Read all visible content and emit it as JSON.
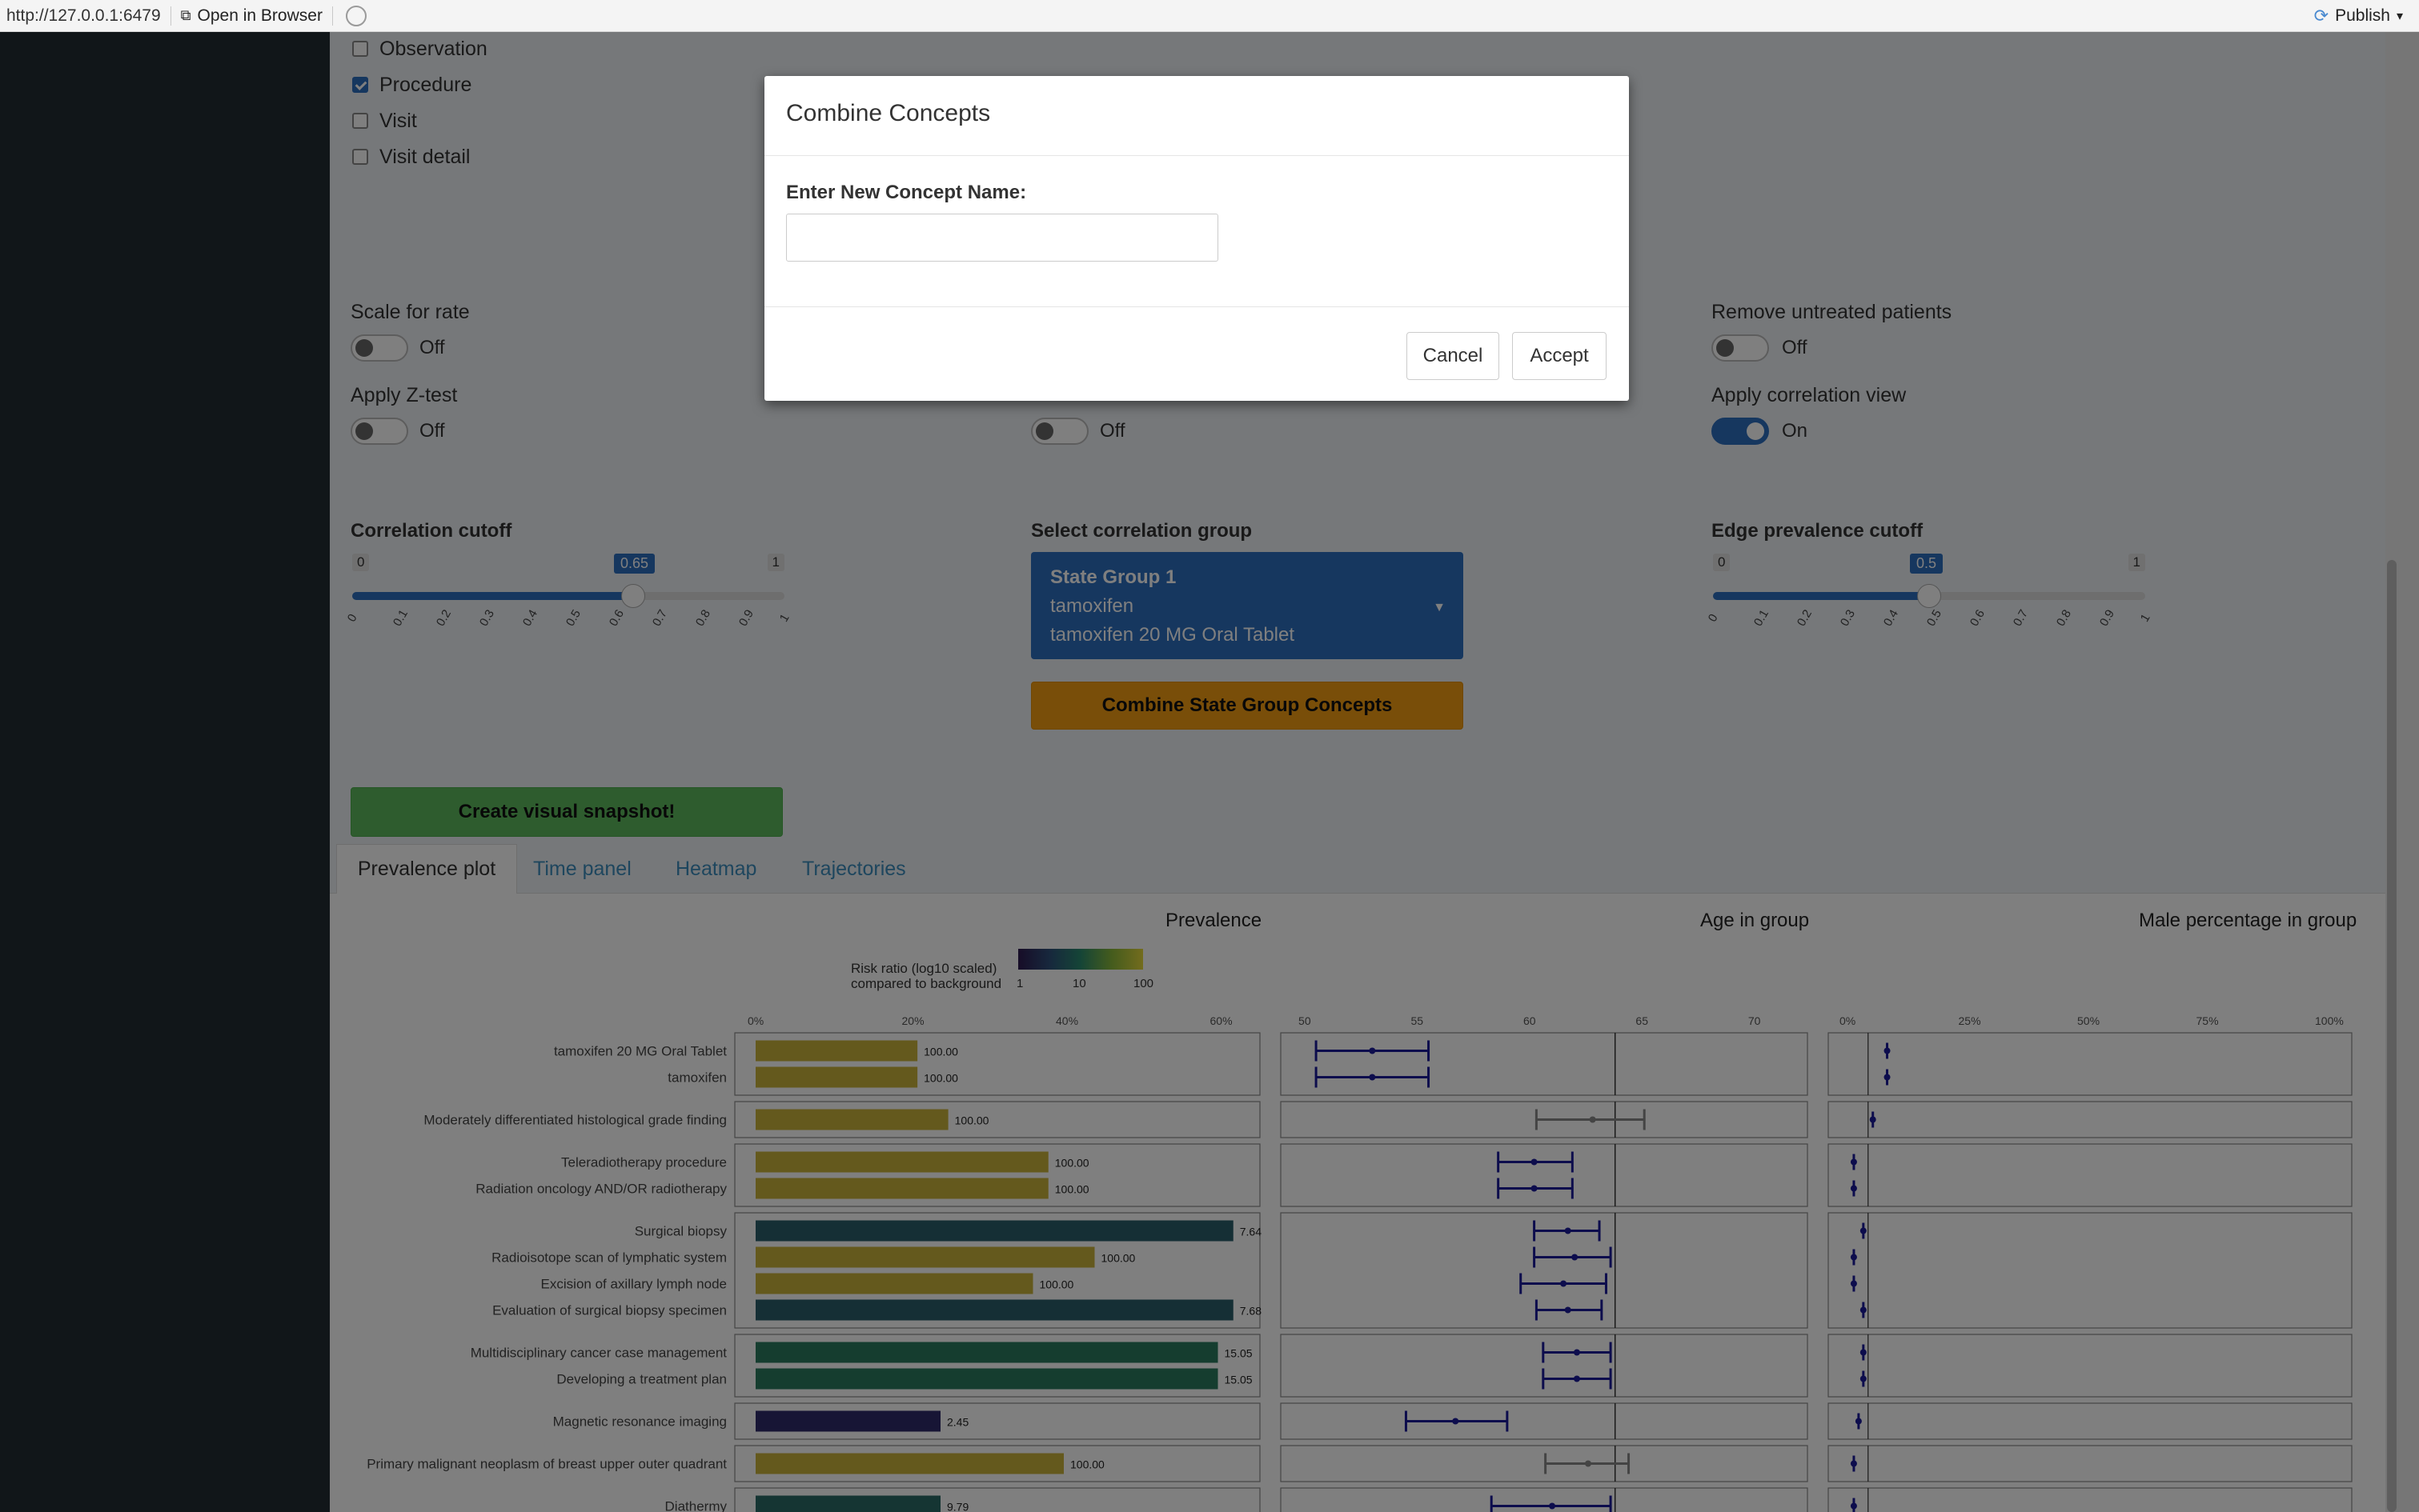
{
  "toolbar": {
    "url": "http://127.0.0.1:6479",
    "open_in_browser": "Open in Browser",
    "publish": "Publish"
  },
  "checkboxes": [
    {
      "label": "Observation",
      "checked": false
    },
    {
      "label": "Procedure",
      "checked": true
    },
    {
      "label": "Visit",
      "checked": false
    },
    {
      "label": "Visit detail",
      "checked": false
    }
  ],
  "toggles": {
    "scale_for_rate": {
      "label": "Scale for rate",
      "state": "Off"
    },
    "apply_z_test": {
      "label": "Apply Z-test",
      "state": "Off"
    },
    "apply_logit_test": {
      "state": "Off"
    },
    "remove_untreated": {
      "label": "Remove untreated patients",
      "state": "Off"
    },
    "apply_correlation_view": {
      "label": "Apply correlation view",
      "state": "On"
    }
  },
  "correlation_cutoff": {
    "label": "Correlation cutoff",
    "min": "0",
    "max": "1",
    "value": "0.65",
    "fraction": 0.65,
    "ticks": [
      "0",
      "0.1",
      "0.2",
      "0.3",
      "0.4",
      "0.5",
      "0.6",
      "0.7",
      "0.8",
      "0.9",
      "1"
    ]
  },
  "edge_prevalence_cutoff": {
    "label": "Edge prevalence cutoff",
    "min": "0",
    "max": "1",
    "value": "0.5",
    "fraction": 0.5,
    "ticks": [
      "0",
      "0.1",
      "0.2",
      "0.3",
      "0.4",
      "0.5",
      "0.6",
      "0.7",
      "0.8",
      "0.9",
      "1"
    ]
  },
  "correlation_group": {
    "label": "Select correlation group",
    "title": "State Group 1",
    "items": [
      "tamoxifen",
      "tamoxifen 20 MG Oral Tablet"
    ]
  },
  "buttons": {
    "combine": "Combine State Group Concepts",
    "snapshot": "Create visual snapshot!"
  },
  "tabs": [
    "Prevalence plot",
    "Time panel",
    "Heatmap",
    "Trajectories"
  ],
  "plot": {
    "prevalence_title": "Prevalence",
    "age_title": "Age in group",
    "male_title": "Male percentage in group",
    "legend_title_1": "Risk ratio (log10 scaled)",
    "legend_title_2": "compared to background",
    "legend_ticks": [
      "1",
      "10",
      "100"
    ],
    "prev_axis": [
      "0%",
      "20%",
      "40%",
      "60%"
    ],
    "age_axis": [
      "50",
      "55",
      "60",
      "65",
      "70"
    ],
    "male_axis": [
      "0%",
      "25%",
      "50%",
      "75%",
      "100%"
    ]
  },
  "chart_data": {
    "type": "bar",
    "categories": [
      "tamoxifen 20 MG Oral Tablet",
      "tamoxifen",
      "Moderately differentiated histological grade finding",
      "Teleradiotherapy procedure",
      "Radiation oncology AND/OR radiotherapy",
      "Surgical biopsy",
      "Radioisotope scan of lymphatic system",
      "Excision of axillary lymph node",
      "Evaluation of surgical biopsy specimen",
      "Multidisciplinary cancer case management",
      "Developing a treatment plan",
      "Magnetic resonance imaging",
      "Primary malignant neoplasm of breast upper outer quadrant",
      "Diathermy"
    ],
    "groups": [
      2,
      1,
      2,
      4,
      2,
      1,
      1,
      1
    ],
    "values": [
      21,
      21,
      25,
      38,
      38,
      62,
      44,
      36,
      62,
      60,
      60,
      24,
      40,
      24
    ],
    "labels": [
      "100.00",
      "100.00",
      "100.00",
      "100.00",
      "100.00",
      "7.64",
      "100.00",
      "100.00",
      "7.68",
      "15.05",
      "15.05",
      "2.45",
      "100.00",
      "9.79"
    ],
    "colors": [
      "#c9b33a",
      "#c9b33a",
      "#c9b33a",
      "#c9b33a",
      "#c9b33a",
      "#2a5f6a",
      "#c9b33a",
      "#c9b33a",
      "#2a5f6a",
      "#2a7a5e",
      "#2a7a5e",
      "#2e2a6a",
      "#c9b33a",
      "#2a6a66"
    ],
    "age_ranges": [
      [
        50.5,
        55.5
      ],
      [
        50.5,
        55.5
      ],
      [
        60.3,
        65.1
      ],
      [
        58.6,
        61.9
      ],
      [
        58.6,
        61.9
      ],
      [
        60.2,
        63.1
      ],
      [
        60.2,
        63.6
      ],
      [
        59.6,
        63.4
      ],
      [
        60.3,
        63.2
      ],
      [
        60.6,
        63.6
      ],
      [
        60.6,
        63.6
      ],
      [
        54.5,
        59
      ],
      [
        60.7,
        64.4
      ],
      [
        58.3,
        63.6
      ]
    ],
    "age_points": [
      53,
      53,
      62.8,
      60.2,
      60.2,
      61.7,
      62,
      61.5,
      61.7,
      62.1,
      62.1,
      56.7,
      62.6,
      61
    ],
    "male_points": [
      8,
      8,
      5,
      1,
      1,
      3,
      1,
      1,
      3,
      3,
      3,
      2,
      1,
      1
    ],
    "xlabel": "",
    "ylabel": "",
    "xlim": [
      0,
      64
    ]
  },
  "modal": {
    "title": "Combine Concepts",
    "label": "Enter New Concept Name:",
    "cancel": "Cancel",
    "accept": "Accept"
  }
}
